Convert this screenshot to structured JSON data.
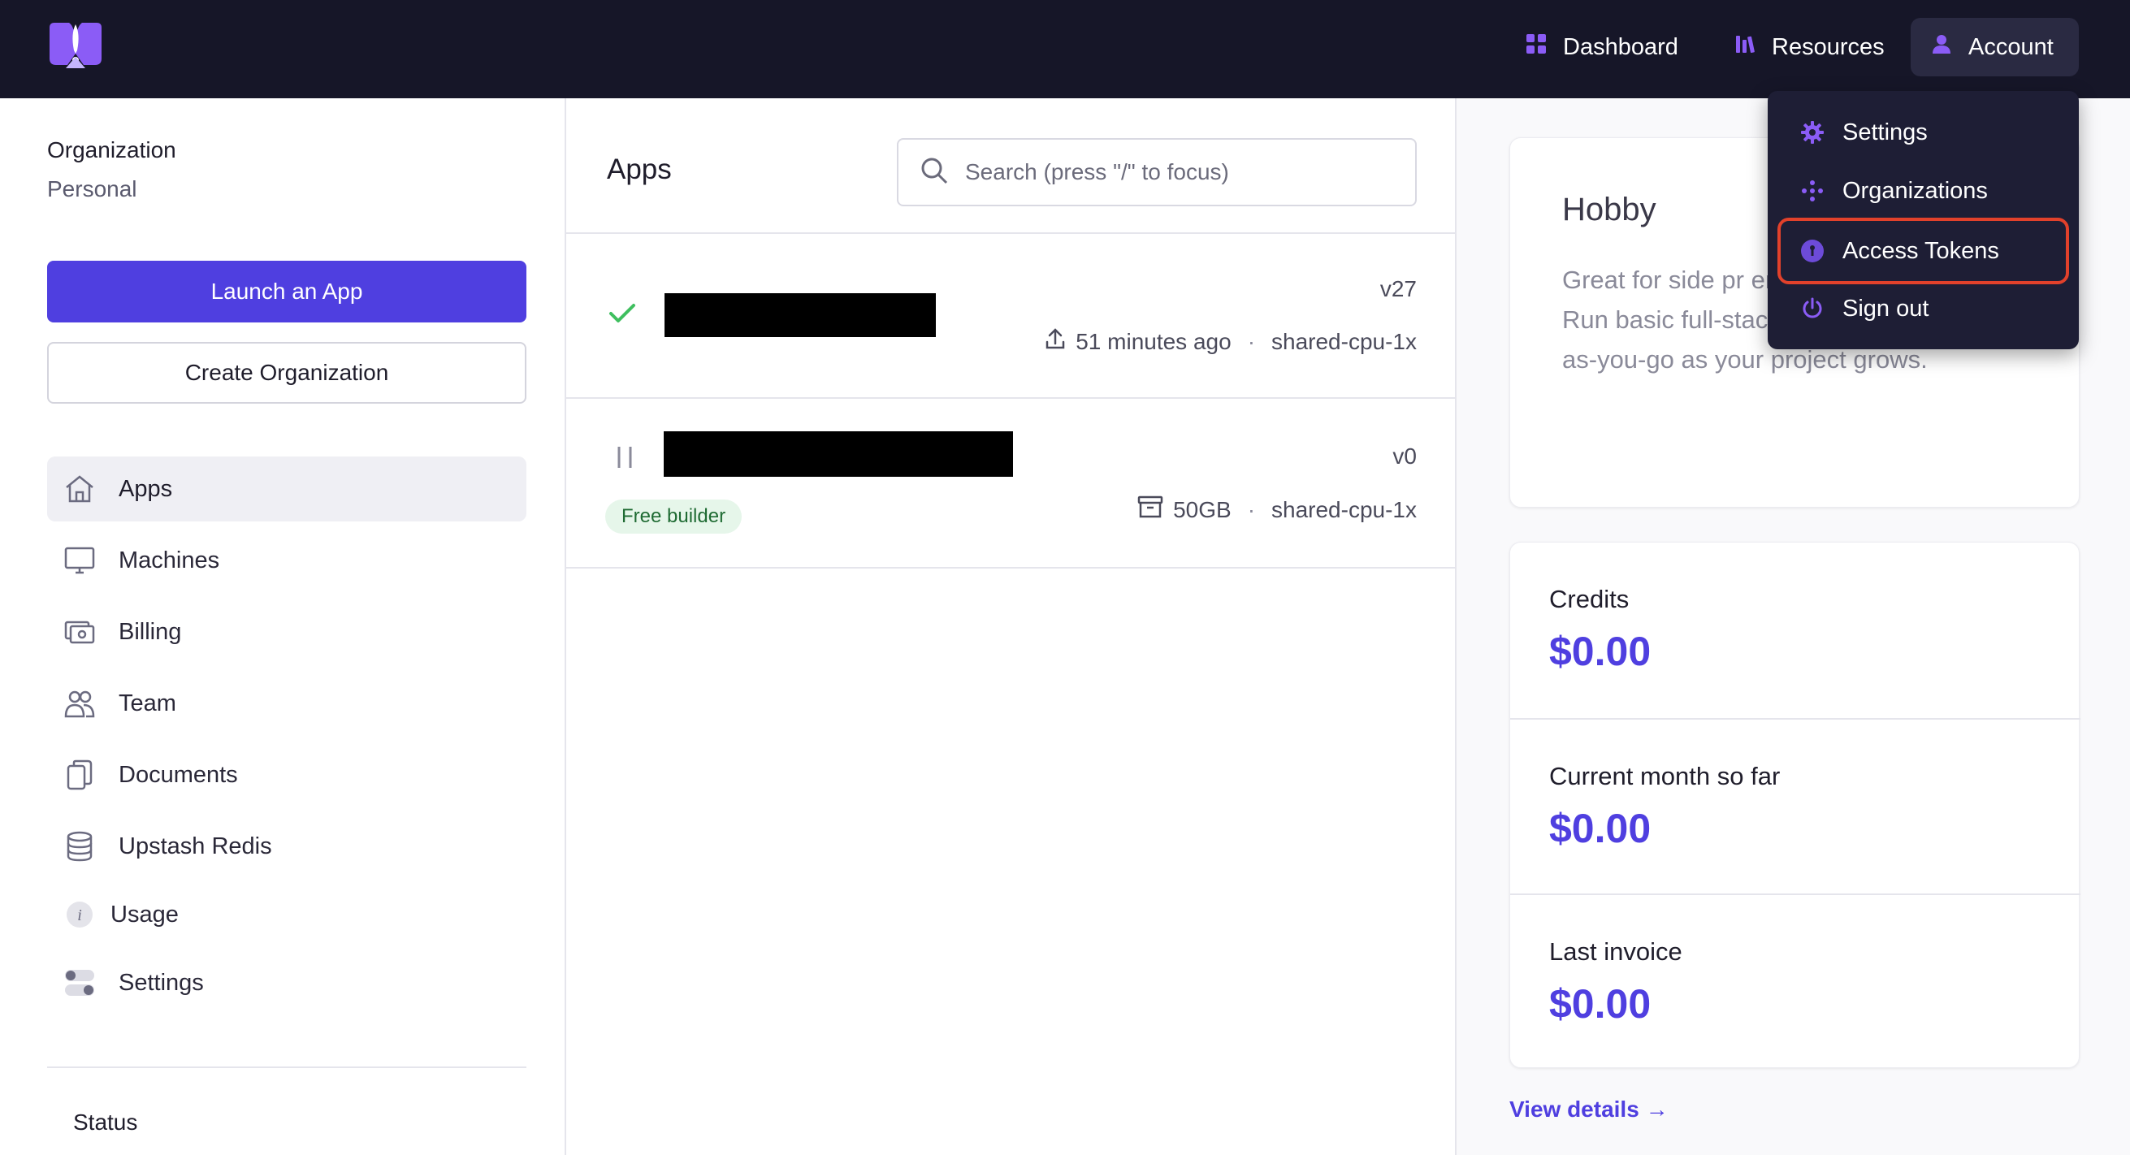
{
  "navbar": {
    "dashboard_label": "Dashboard",
    "resources_label": "Resources",
    "account_label": "Account"
  },
  "account_menu": {
    "items": [
      {
        "label": "Settings",
        "icon": "gear-icon"
      },
      {
        "label": "Organizations",
        "icon": "organizations-icon"
      },
      {
        "label": "Access Tokens",
        "icon": "key-icon",
        "highlighted": true
      },
      {
        "label": "Sign out",
        "icon": "power-icon"
      }
    ]
  },
  "sidebar": {
    "org_label": "Organization",
    "org_value": "Personal",
    "launch_button": "Launch an App",
    "create_org_button": "Create Organization",
    "items": [
      {
        "label": "Apps",
        "icon": "home-icon",
        "active": true
      },
      {
        "label": "Machines",
        "icon": "monitor-icon"
      },
      {
        "label": "Billing",
        "icon": "billing-icon"
      },
      {
        "label": "Team",
        "icon": "team-icon"
      },
      {
        "label": "Documents",
        "icon": "documents-icon"
      },
      {
        "label": "Upstash Redis",
        "icon": "database-icon"
      },
      {
        "label": "Usage",
        "icon": "info-icon"
      },
      {
        "label": "Settings",
        "icon": "toggle-icon"
      }
    ],
    "status_label": "Status"
  },
  "apps": {
    "title": "Apps",
    "search_placeholder": "Search (press \"/\" to focus)",
    "list": [
      {
        "status": "deployed",
        "version": "v27",
        "meta_primary": "51 minutes ago",
        "meta_secondary": "shared-cpu-1x",
        "badge": ""
      },
      {
        "status": "suspended",
        "version": "v0",
        "meta_primary": "50GB",
        "meta_secondary": "shared-cpu-1x",
        "badge": "Free builder"
      }
    ]
  },
  "plan": {
    "title": "Hobby",
    "description": "Great for side pr environments, or use Fly. Run basic full-stack apps for free, and pay-as-you-go as your project grows."
  },
  "billing": {
    "credits_label": "Credits",
    "credits_value": "$0.00",
    "current_label": "Current month so far",
    "current_value": "$0.00",
    "last_invoice_label": "Last invoice",
    "last_invoice_value": "$0.00",
    "view_details": "View details →"
  },
  "colors": {
    "navbar_bg": "#161628",
    "accent": "#4f3fe0",
    "highlight": "#e2412b",
    "success": "#3fbf5f"
  }
}
